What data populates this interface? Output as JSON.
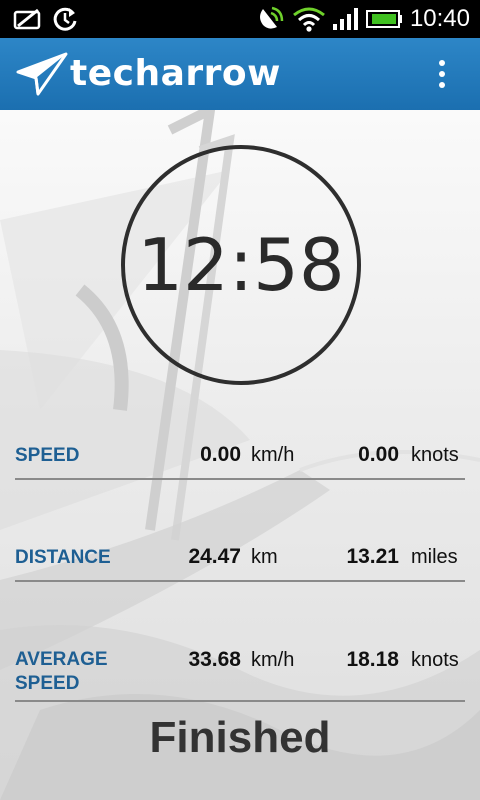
{
  "status_bar": {
    "time": "10:40"
  },
  "app": {
    "name": "techarrow"
  },
  "timer": {
    "value": "12:58"
  },
  "stats": {
    "speed": {
      "label": "SPEED",
      "kmh": "0.00",
      "kmh_unit": "km/h",
      "knots": "0.00",
      "knots_unit": "knots"
    },
    "distance": {
      "label": "DISTANCE",
      "km": "24.47",
      "km_unit": "km",
      "miles": "13.21",
      "miles_unit": "miles"
    },
    "average_speed": {
      "label_line1": "AVERAGE",
      "label_line2": "SPEED",
      "kmh": "33.68",
      "kmh_unit": "km/h",
      "knots": "18.18",
      "knots_unit": "knots"
    }
  },
  "status": "Finished",
  "icons": {
    "status_bar": [
      "screenshot-icon",
      "sync-icon",
      "location-signal-icon",
      "wifi-icon",
      "cell-signal-icon",
      "battery-icon"
    ],
    "app_bar": [
      "paper-plane-logo-icon",
      "overflow-menu-icon"
    ]
  },
  "colors": {
    "app_bar": "#1f74b5",
    "label": "#1e5f93",
    "battery": "#40c020",
    "wifi": "#6fd12b"
  }
}
